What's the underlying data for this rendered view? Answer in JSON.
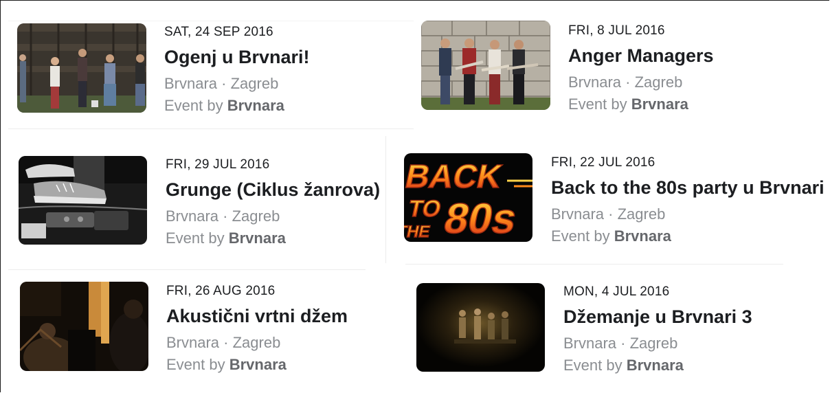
{
  "events": [
    {
      "date": "SAT, 24 SEP 2016",
      "title": "Ogenj u Brvnari!",
      "venue": "Brvnara",
      "separator": " · ",
      "city": "Zagreb",
      "host_prefix": "Event by ",
      "host": "Brvnara",
      "thumbnail": "band-photo-wooden-barn"
    },
    {
      "date": "FRI, 8 JUL 2016",
      "title": "Anger Managers",
      "venue": "Brvnara",
      "separator": " · ",
      "city": "Zagreb",
      "host_prefix": "Event by ",
      "host": "Brvnara",
      "thumbnail": "band-photo-stone-wall"
    },
    {
      "date": "FRI, 29 JUL 2016",
      "title": "Grunge (Ciklus žanrova)",
      "venue": "Brvnara",
      "separator": " · ",
      "city": "Zagreb",
      "host_prefix": "Event by ",
      "host": "Brvnara",
      "thumbnail": "sneaker-guitar-pedals-bw"
    },
    {
      "date": "FRI, 22 JUL 2016",
      "title": "Back to the 80s party u Brvnari",
      "venue": "Brvnara",
      "separator": " · ",
      "city": "Zagreb",
      "host_prefix": "Event by ",
      "host": "Brvnara",
      "thumbnail": "back-to-the-80s-logo",
      "thumbnail_text": [
        "BACK",
        "TO",
        "THE",
        "80s"
      ]
    },
    {
      "date": "FRI, 26 AUG 2016",
      "title": "Akustični vrtni džem",
      "venue": "Brvnara",
      "separator": " · ",
      "city": "Zagreb",
      "host_prefix": "Event by ",
      "host": "Brvnara",
      "thumbnail": "dim-acoustic-jam"
    },
    {
      "date": "MON, 4 JUL 2016",
      "title": "Džemanje u Brvnari 3",
      "venue": "Brvnara",
      "separator": " · ",
      "city": "Zagreb",
      "host_prefix": "Event by ",
      "host": "Brvnara",
      "thumbnail": "dark-stage-band"
    }
  ],
  "colors": {
    "text_primary": "#1c1e21",
    "text_secondary": "#8a8d91",
    "host_name": "#65676b",
    "divider": "#ececec"
  }
}
